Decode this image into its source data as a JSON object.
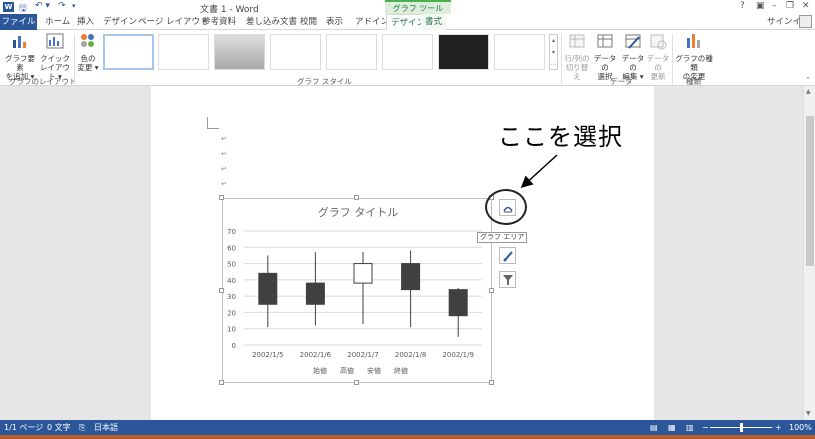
{
  "titlebar": {
    "doc_title": "文書 1 - Word",
    "tool_context": "グラフ ツール",
    "help": "?",
    "ribbon_display": "▣",
    "minimize": "–",
    "restore": "❐",
    "close": "✕"
  },
  "tabs": {
    "file": "ファイル",
    "home": "ホーム",
    "insert": "挿入",
    "design": "デザイン",
    "layout": "ページ レイアウト",
    "references": "参考資料",
    "mailings": "差し込み文書",
    "review": "校閲",
    "view": "表示",
    "addins": "アドイン",
    "chart_design": "デザイン",
    "chart_format": "書式",
    "signin": "サインイン"
  },
  "ribbon": {
    "add_element": [
      "グラフ要素",
      "を追加 ▾"
    ],
    "quick_layout": [
      "クイック",
      "レイアウト ▾"
    ],
    "group_layout": "グラフのレイアウト",
    "change_colors": [
      "色の",
      "変更 ▾"
    ],
    "group_styles": "グラフ スタイル",
    "switch_row_col": [
      "行/列の",
      "切り替え"
    ],
    "select_data": [
      "データの",
      "選択"
    ],
    "edit_data": [
      "データの",
      "編集 ▾"
    ],
    "refresh_data": [
      "データの",
      "更新"
    ],
    "group_data": "データ",
    "change_type": [
      "グラフの種類",
      "の変更"
    ],
    "group_type": "種類"
  },
  "annotation": {
    "text": "ここを選択"
  },
  "tooltip": "グラフ エリア",
  "colors": {
    "word_blue": "#2b579a",
    "chart_green": "#217346",
    "candle_down": "#404040",
    "candle_up": "#ffffff"
  },
  "chart_data": {
    "type": "stock",
    "title": "グラフ タイトル",
    "categories": [
      "2002/1/5",
      "2002/1/6",
      "2002/1/7",
      "2002/1/8",
      "2002/1/9"
    ],
    "series": [
      {
        "name": "始値",
        "values": [
          44,
          38,
          38,
          50,
          34
        ]
      },
      {
        "name": "高値",
        "values": [
          55,
          57,
          57,
          58,
          35
        ]
      },
      {
        "name": "安値",
        "values": [
          11,
          12,
          13,
          11,
          5
        ]
      },
      {
        "name": "終値",
        "values": [
          25,
          25,
          50,
          34,
          18
        ]
      }
    ],
    "ylim": [
      0,
      70
    ],
    "yticks": [
      0,
      10,
      20,
      30,
      40,
      50,
      60,
      70
    ],
    "grid": true,
    "legend": "bottom"
  },
  "status": {
    "page": "1/1 ページ",
    "words": "0 文字",
    "language": "日本語",
    "zoom": "100%",
    "zoom_minus": "−",
    "zoom_plus": "+"
  }
}
